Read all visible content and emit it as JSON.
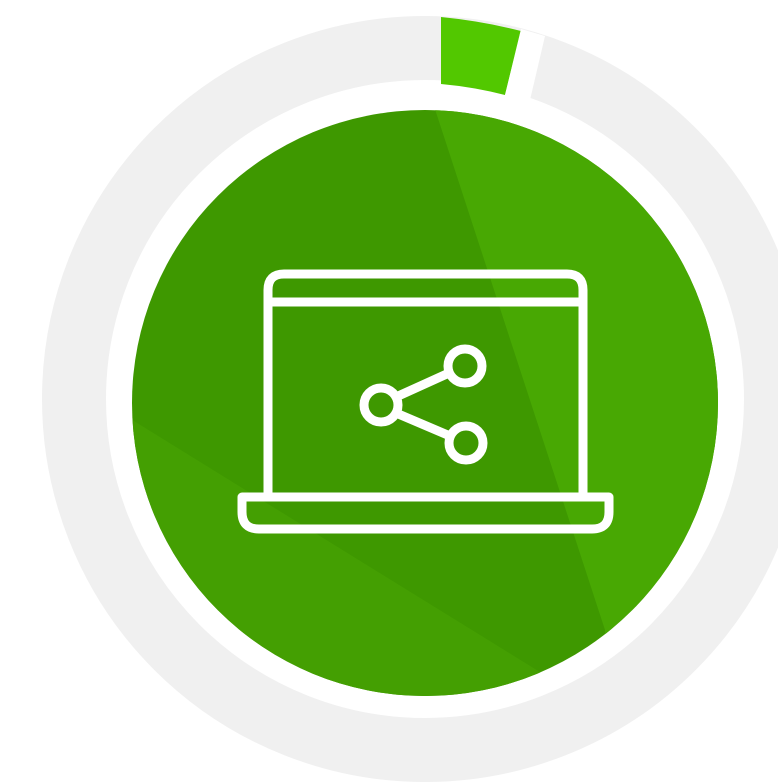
{
  "colors": {
    "background": "#ffffff",
    "ring_track": "#f0f0f0",
    "ring_accent": "#52c800",
    "disc_base": "#3e9800",
    "disc_light_sector": "#48a803",
    "disc_lower_sector": "#449f02",
    "icon_stroke": "#ffffff"
  },
  "icons": {
    "main": "laptop-share-icon",
    "screen_symbol": "share-icon"
  },
  "ring": {
    "accent_fraction": 0.04
  }
}
